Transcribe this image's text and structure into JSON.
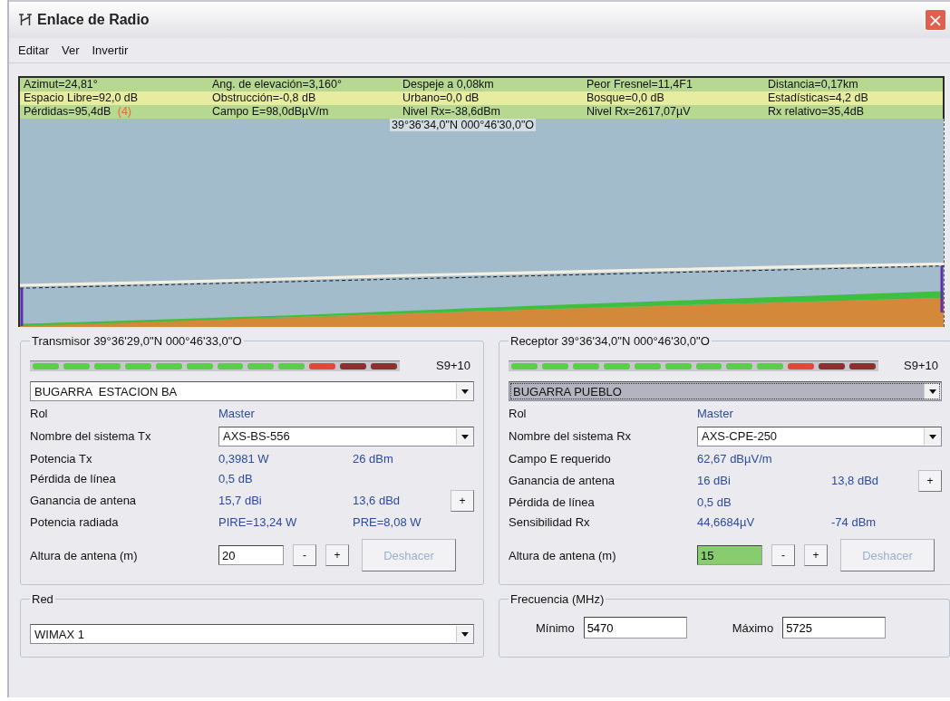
{
  "window": {
    "title": "Enlace de Radio",
    "close": "×"
  },
  "menu": [
    {
      "label": "Editar"
    },
    {
      "label": "Ver"
    },
    {
      "label": "Invertir"
    }
  ],
  "info_rows": [
    {
      "cells": [
        {
          "text": "Azimut=24,81°"
        },
        {
          "text": "Ang. de elevación=3,160°"
        },
        {
          "text": "Despeje a 0,08km"
        },
        {
          "text": "Peor Fresnel=11,4F1"
        },
        {
          "text": "Distancia=0,17km"
        }
      ]
    },
    {
      "cells": [
        {
          "text": "Espacio Libre=92,0 dB"
        },
        {
          "text": "Obstrucción=-0,8 dB"
        },
        {
          "text": "Urbano=0,0 dB"
        },
        {
          "text": "Bosque=0,0 dB"
        },
        {
          "text": "Estadísticas=4,2 dB"
        }
      ]
    },
    {
      "cells": [
        {
          "text": "Pérdidas=95,4dB",
          "note": "(4)"
        },
        {
          "text": "Campo E=98,0dBµV/m"
        },
        {
          "text": "Nivel Rx=-38,6dBm"
        },
        {
          "text": "Nivel Rx=2617,07µV"
        },
        {
          "text": "Rx relativo=35,4dB"
        }
      ]
    }
  ],
  "profile": {
    "coordinates": "39°36'34,0\"N 000°46'30,0\"O"
  },
  "transmitter": {
    "title": "Transmisor 39°36'29,0\"N 000°46'33,0\"O",
    "meter": {
      "reading": "S9+10"
    },
    "site": {
      "value": "BUGARRA  ESTACION BA",
      "selected": false
    },
    "rows": [
      {
        "kind": "text",
        "label": "Rol",
        "values": [
          "Master"
        ]
      },
      {
        "kind": "combo",
        "label": "Nombre del sistema Tx",
        "value": "AXS-BS-556"
      },
      {
        "kind": "text",
        "label": "Potencia Tx",
        "values": [
          "0,3981 W",
          "26 dBm"
        ]
      },
      {
        "kind": "text",
        "label": "Pérdida de línea",
        "values": [
          "0,5 dB"
        ]
      },
      {
        "kind": "text",
        "label": "Ganancia de antena",
        "values": [
          "15,7 dBi",
          "13,6 dBd"
        ],
        "button": "+"
      },
      {
        "kind": "text",
        "label": "Potencia radiada",
        "values": [
          "PIRE=13,24 W",
          "PRE=8,08 W"
        ]
      }
    ],
    "height": {
      "label": "Altura de antena (m)",
      "value": "20",
      "highlighted": false,
      "minus": "-",
      "plus": "+",
      "undo": "Deshacer",
      "undo_disabled": true
    }
  },
  "receiver": {
    "title": "Receptor 39°36'34,0\"N 000°46'30,0\"O",
    "meter": {
      "reading": "S9+10"
    },
    "site": {
      "value": "BUGARRA PUEBLO",
      "selected": true
    },
    "rows": [
      {
        "kind": "text",
        "label": "Rol",
        "values": [
          "Master"
        ]
      },
      {
        "kind": "combo",
        "label": "Nombre del sistema Rx",
        "value": "AXS-CPE-250"
      },
      {
        "kind": "text",
        "label": "Campo E requerido",
        "values": [
          "62,67 dBµV/m"
        ]
      },
      {
        "kind": "text",
        "label": "Ganancia de antena",
        "values": [
          "16 dBi",
          "13,8 dBd"
        ],
        "button": "+"
      },
      {
        "kind": "text",
        "label": "Pérdida de línea",
        "values": [
          "0,5 dB"
        ]
      },
      {
        "kind": "text",
        "label": "Sensibilidad Rx",
        "values": [
          "44,6684µV",
          "-74 dBm"
        ]
      }
    ],
    "height": {
      "label": "Altura de antena (m)",
      "value": "15",
      "highlighted": true,
      "minus": "-",
      "plus": "+",
      "undo": "Deshacer",
      "undo_disabled": true
    }
  },
  "network": {
    "title": "Red",
    "value": "WIMAX 1"
  },
  "frequency": {
    "title": "Frecuencia (MHz)",
    "min_label": "Mínimo",
    "min": "5470",
    "max_label": "Máximo",
    "max": "5725"
  }
}
